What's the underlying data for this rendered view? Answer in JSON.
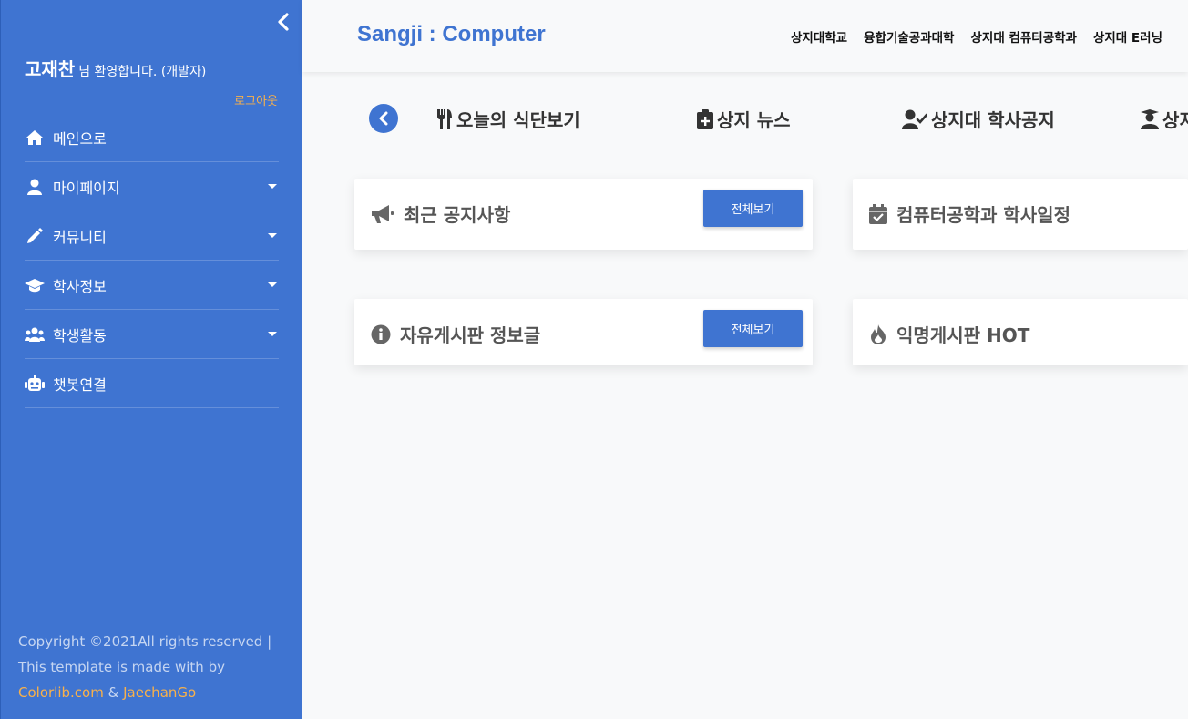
{
  "sidebar": {
    "user_name": "고재찬",
    "welcome": "님 환영합니다. (개발자)",
    "logout": "로그아웃",
    "items": [
      {
        "label": "메인으로",
        "icon": "home-icon",
        "dropdown": false
      },
      {
        "label": "마이페이지",
        "icon": "user-icon",
        "dropdown": true
      },
      {
        "label": "커뮤니티",
        "icon": "pencil-icon",
        "dropdown": true
      },
      {
        "label": "학사정보",
        "icon": "graduation-cap-icon",
        "dropdown": true
      },
      {
        "label": "학생활동",
        "icon": "users-icon",
        "dropdown": true
      },
      {
        "label": "챗봇연결",
        "icon": "robot-icon",
        "dropdown": false
      }
    ],
    "footer": {
      "text1": "Copyright ©2021All rights reserved | This template is made with by",
      "link1": "Colorlib.com",
      "amp": "&",
      "link2": "JaechanGo"
    }
  },
  "topbar": {
    "brand": "Sangji : Computer",
    "links": [
      "상지대학교",
      "융합기술공과대학",
      "상지대 컴퓨터공학과",
      "상지대 E러닝"
    ]
  },
  "quicknav": {
    "items": [
      {
        "label": "오늘의 식단보기",
        "icon": "utensils-icon"
      },
      {
        "label": "상지 뉴스",
        "icon": "clipboard-plus-icon"
      },
      {
        "label": "상지대 학사공지",
        "icon": "user-check-icon"
      },
      {
        "label": "상지",
        "icon": "user-graduate-icon"
      }
    ]
  },
  "cards": [
    {
      "title": "최근 공지사항",
      "icon": "megaphone-icon",
      "button": "전체보기"
    },
    {
      "title": "컴퓨터공학과 학사일정",
      "icon": "calendar-check-icon"
    },
    {
      "title": "자유게시판 정보글",
      "icon": "info-circle-icon",
      "button": "전체보기"
    },
    {
      "title": "익명게시판 HOT",
      "icon": "fire-icon"
    }
  ],
  "colors": {
    "primary": "#3f74d1",
    "accent": "#f9b14a",
    "background": "#f8f9fa"
  }
}
